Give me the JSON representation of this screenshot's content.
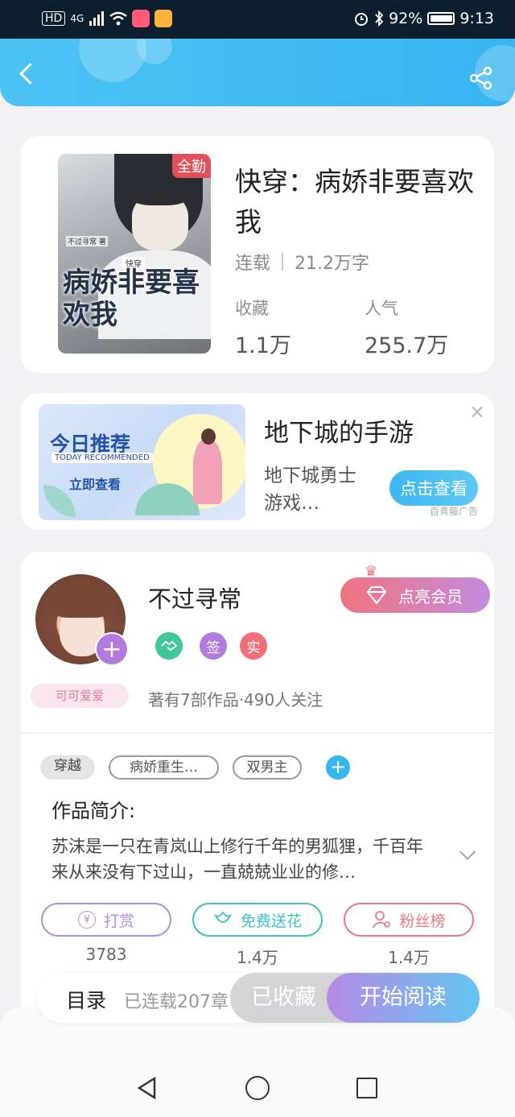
{
  "status_bar": {
    "signal": "4G",
    "battery": "92%",
    "time": "9:13"
  },
  "book": {
    "title": "快穿：病娇非要喜欢我",
    "badge": "全勤",
    "cover_title": "病娇非要喜欢我",
    "cover_subtitle": "快穿",
    "cover_author": "不过寻常 著",
    "status": "连载",
    "word_count": "21.2万字",
    "collect_label": "收藏",
    "collect_value": "1.1万",
    "popularity_label": "人气",
    "popularity_value": "255.7万"
  },
  "ad": {
    "image_line1": "今日推荐",
    "image_line2": "TODAY RECOMMENDED",
    "image_line3": "立即查看",
    "title": "地下城的手游",
    "description": "地下城勇士游戏…",
    "button": "点击查看",
    "source": "百青藤广告"
  },
  "author": {
    "name": "不过寻常",
    "tag": "可可爱爱",
    "vip_button": "点亮会员",
    "badges": [
      "签",
      "实"
    ],
    "works_info": "著有7部作品·490人关注"
  },
  "tags": [
    "穿越",
    "病娇重生…",
    "双男主"
  ],
  "intro": {
    "title": "作品简介:",
    "text": "苏沫是一只在青岚山上修行千年的男狐狸，千百年来从来没有下过山，一直兢兢业业的修…"
  },
  "actions": [
    {
      "label": "打赏",
      "count": "3783",
      "color": "#b48be0",
      "icon": "yen-icon"
    },
    {
      "label": "免费送花",
      "count": "1.4万",
      "color": "#3fc3c9",
      "icon": "flower-icon"
    },
    {
      "label": "粉丝榜",
      "count": "1.4万",
      "color": "#e97a80",
      "icon": "fan-ranking-icon"
    }
  ],
  "bottom_bar": {
    "toc": "目录",
    "serial": "已连载207章",
    "collected": "已收藏",
    "read": "开始阅读"
  },
  "colors": {
    "accent": "#38b4f0",
    "vip": "#f0747e",
    "purple": "#b07bdc"
  }
}
